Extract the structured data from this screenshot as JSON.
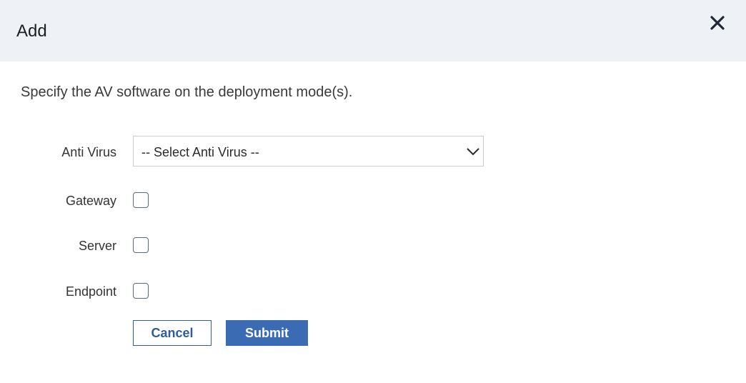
{
  "dialog": {
    "title": "Add",
    "close_icon": "close-icon"
  },
  "description": "Specify the AV software on the deployment mode(s).",
  "form": {
    "anti_virus": {
      "label": "Anti Virus",
      "selected_value": "-- Select Anti Virus --",
      "icon": "chevron-down-icon"
    },
    "gateway": {
      "label": "Gateway",
      "checked": false
    },
    "server": {
      "label": "Server",
      "checked": false
    },
    "endpoint": {
      "label": "Endpoint",
      "checked": false
    }
  },
  "actions": {
    "cancel_label": "Cancel",
    "submit_label": "Submit"
  },
  "colors": {
    "header_bg": "#eef2f6",
    "primary": "#3b6bb2",
    "primary_border": "#2f5d9a"
  }
}
